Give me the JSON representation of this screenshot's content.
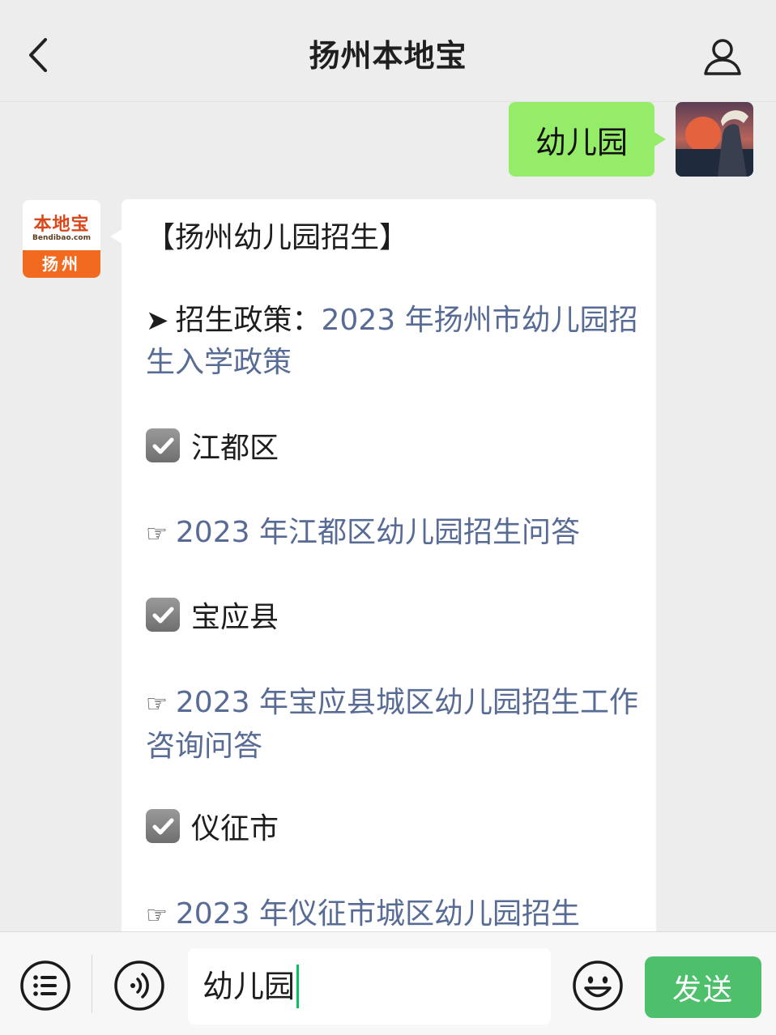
{
  "header": {
    "title": "扬州本地宝",
    "back_icon": "chevron-left-icon",
    "profile_icon": "person-icon"
  },
  "sent_message": {
    "text": "幼儿园"
  },
  "bot": {
    "avatar_brand": "本地宝",
    "avatar_domain": "Bendibao.com",
    "avatar_city": "扬州"
  },
  "reply": {
    "title": "【扬州幼儿园招生】",
    "policy_prefix": "招生政策：",
    "policy_link": "2023 年扬州市幼儿园招生入学政策",
    "sections": [
      {
        "district": "江都区",
        "link": "2023 年江都区幼儿园招生问答"
      },
      {
        "district": "宝应县",
        "link": "2023 年宝应县城区幼儿园招生工作咨询问答"
      },
      {
        "district": "仪征市",
        "link": "2023 年仪征市城区幼儿园招生"
      }
    ]
  },
  "inputbar": {
    "input_value": "幼儿园",
    "send_label": "发送",
    "menu_icon": "menu-list-icon",
    "voice_icon": "voice-icon",
    "emoji_icon": "emoji-icon"
  },
  "colors": {
    "link": "#576b95",
    "sent_bubble": "#95ec69",
    "send_button": "#4ec06c",
    "accent_caret": "#07c160"
  }
}
